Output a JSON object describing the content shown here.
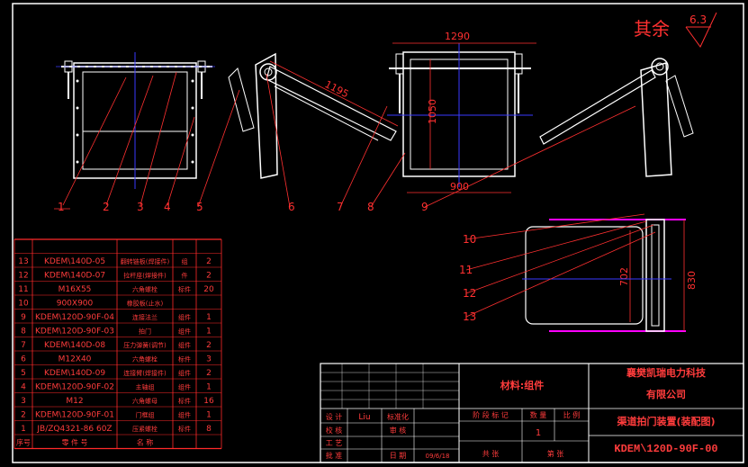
{
  "colors": {
    "background": "#000000",
    "frame": "#ffffff",
    "leader": "#ff2a2a",
    "centerline": "#1a1aff",
    "table_line": "#ff2a2a",
    "table_text": "#ff3c3c",
    "label_text": "#ff3030",
    "dim_line": "#ff3030",
    "accent": "#ff00ff",
    "component": "#ffffff"
  },
  "surface_mark": {
    "label": "其余",
    "value": "6.3"
  },
  "dimensions": {
    "width_top": "1290",
    "height_side": "1050",
    "diagonal": "1195",
    "width_bottom": "900",
    "plan_height": "830",
    "plan_inner": "702"
  },
  "callouts": [
    "1",
    "2",
    "3",
    "4",
    "5",
    "6",
    "7",
    "8",
    "9",
    "10",
    "11",
    "12",
    "13"
  ],
  "parts_list": {
    "rows": [
      {
        "no": "13",
        "code": "KDEM\\140D-05",
        "name": "翻转链板(焊接件)",
        "mat": "组",
        "qty": "2"
      },
      {
        "no": "12",
        "code": "KDEM\\140D-07",
        "name": "拉杆座(焊接件)",
        "mat": "件",
        "qty": "2"
      },
      {
        "no": "11",
        "code": "M16X55",
        "name": "六角螺栓",
        "mat": "标件",
        "qty": "20"
      },
      {
        "no": "10",
        "code": "900X900",
        "name": "橡胶板(止水)",
        "mat": "",
        "qty": ""
      },
      {
        "no": "9",
        "code": "KDEM\\120D-90F-04",
        "name": "连接法兰",
        "mat": "组件",
        "qty": "1"
      },
      {
        "no": "8",
        "code": "KDEM\\120D-90F-03",
        "name": "拍门",
        "mat": "组件",
        "qty": "1"
      },
      {
        "no": "7",
        "code": "KDEM\\140D-08",
        "name": "压力弹簧(调节)",
        "mat": "组件",
        "qty": "2"
      },
      {
        "no": "6",
        "code": "M12X40",
        "name": "六角螺栓",
        "mat": "标件",
        "qty": "3"
      },
      {
        "no": "5",
        "code": "KDEM\\140D-09",
        "name": "连接臂(焊接件)",
        "mat": "组件",
        "qty": "2"
      },
      {
        "no": "4",
        "code": "KDEM\\120D-90F-02",
        "name": "主轴组",
        "mat": "组件",
        "qty": "1"
      },
      {
        "no": "3",
        "code": "M12",
        "name": "六角螺母",
        "mat": "标件",
        "qty": "16"
      },
      {
        "no": "2",
        "code": "KDEM\\120D-90F-01",
        "name": "门框组",
        "mat": "组件",
        "qty": "1"
      },
      {
        "no": "1",
        "code": "JB/ZQ4321-86 60Z",
        "name": "压紧螺栓",
        "mat": "标件",
        "qty": "8"
      }
    ],
    "header": {
      "no": "序号",
      "code": "零 件 号",
      "name": "名 称",
      "mat": "",
      "qty": ""
    }
  },
  "title_block": {
    "material": "材料:组件",
    "company_line1": "襄樊凯瑞电力科技",
    "company_line2": "有限公司",
    "drawing_name": "渠道拍门装置(装配图)",
    "drawing_code": "KDEM\\120D-90F-00",
    "qty_value": "1",
    "designer_role": "设 计",
    "designer": "Liu",
    "standard_role": "标准化",
    "check_role": "校 核",
    "review_role": "审 核",
    "process_role": "工 艺",
    "approve_role": "批 准",
    "date_label": "日 期",
    "date": "09/6/18",
    "stage_header": "阶 段 标 记",
    "weight_header": "数 量",
    "ratio_header": "比 例",
    "sheet_total": "共  张",
    "sheet_no": "第  张"
  }
}
